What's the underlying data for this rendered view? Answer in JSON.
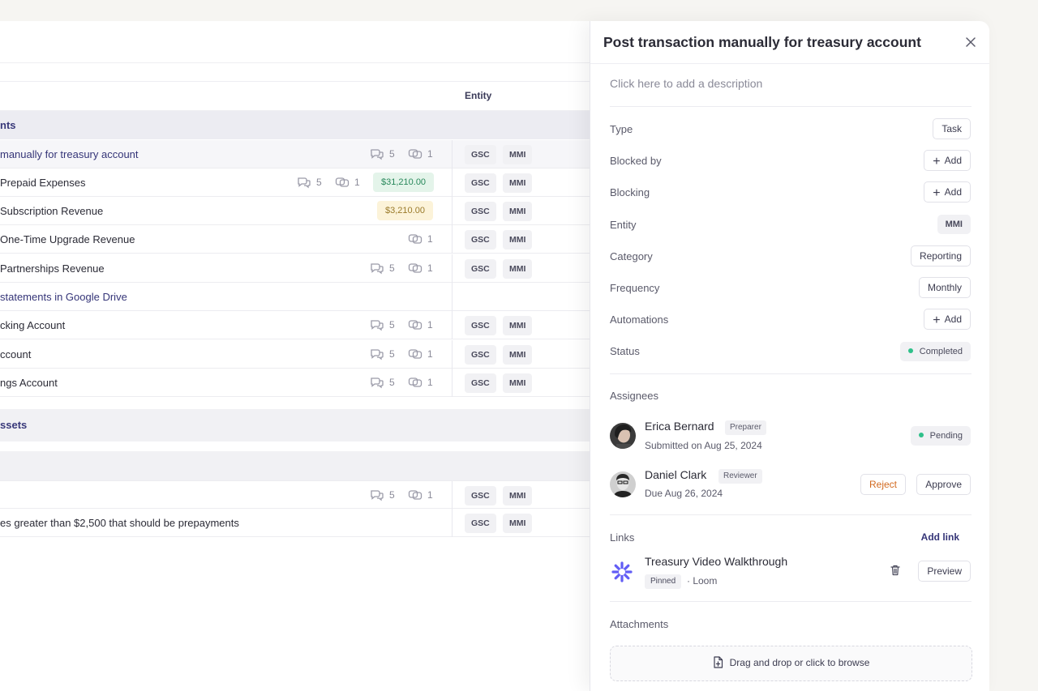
{
  "table": {
    "entity_header": "Entity",
    "rows": [
      {
        "name": "nts",
        "kind": "group"
      },
      {
        "name": "manually for treasury account",
        "kind": "link",
        "comments": "5",
        "links": "1",
        "entities": [
          "GSC",
          "MMI"
        ]
      },
      {
        "name": "Prepaid Expenses",
        "comments": "5",
        "links": "1",
        "amount": "$31,210.00",
        "amount_color": "green",
        "entities": [
          "GSC",
          "MMI"
        ]
      },
      {
        "name": "Subscription Revenue",
        "amount": "$3,210.00",
        "amount_color": "yellow",
        "entities": [
          "GSC",
          "MMI"
        ]
      },
      {
        "name": "One-Time Upgrade Revenue",
        "links": "1",
        "entities": [
          "GSC",
          "MMI"
        ]
      },
      {
        "name": "Partnerships Revenue",
        "comments": "5",
        "links": "1",
        "entities": [
          "GSC",
          "MMI"
        ]
      },
      {
        "name": "statements in Google Drive",
        "kind": "link"
      },
      {
        "name": "cking Account",
        "comments": "5",
        "links": "1",
        "entities": [
          "GSC",
          "MMI"
        ]
      },
      {
        "name": "ccount",
        "comments": "5",
        "links": "1",
        "entities": [
          "GSC",
          "MMI"
        ]
      },
      {
        "name": "ngs Account",
        "comments": "5",
        "links": "1",
        "entities": [
          "GSC",
          "MMI"
        ]
      },
      {
        "name": "ssets",
        "kind": "group"
      },
      {
        "name": "",
        "kind": "group"
      },
      {
        "name": "",
        "comments": "5",
        "links": "1",
        "entities": [
          "GSC",
          "MMI"
        ]
      },
      {
        "name": "es greater than $2,500 that should be prepayments",
        "entities": [
          "GSC",
          "MMI"
        ]
      }
    ]
  },
  "panel": {
    "title": "Post transaction manually for treasury account",
    "description_placeholder": "Click here to add a description",
    "props": {
      "type_label": "Type",
      "type_value": "Task",
      "blocked_by_label": "Blocked by",
      "blocked_by_btn": "Add",
      "blocking_label": "Blocking",
      "blocking_btn": "Add",
      "entity_label": "Entity",
      "entity_value": "MMI",
      "category_label": "Category",
      "category_value": "Reporting",
      "frequency_label": "Frequency",
      "frequency_value": "Monthly",
      "automations_label": "Automations",
      "automations_btn": "Add",
      "status_label": "Status",
      "status_value": "Completed"
    },
    "assignees": {
      "title": "Assignees",
      "people": [
        {
          "name": "Erica Bernard",
          "role": "Preparer",
          "sub": "Submitted on Aug 25, 2024",
          "status": "Pending"
        },
        {
          "name": "Daniel Clark",
          "role": "Reviewer",
          "sub": "Due Aug 26, 2024",
          "reject": "Reject",
          "approve": "Approve"
        }
      ]
    },
    "links": {
      "title": "Links",
      "add_label": "Add link",
      "item": {
        "title": "Treasury Video Walkthrough",
        "pinned": "Pinned",
        "source": "· Loom",
        "preview": "Preview"
      }
    },
    "attachments": {
      "title": "Attachments",
      "dropzone": "Drag and drop or click to browse"
    },
    "colors": {
      "accent": "#353578",
      "success_dot": "#2fc08a",
      "reject": "#d2691e",
      "loom": "#625df5"
    }
  }
}
